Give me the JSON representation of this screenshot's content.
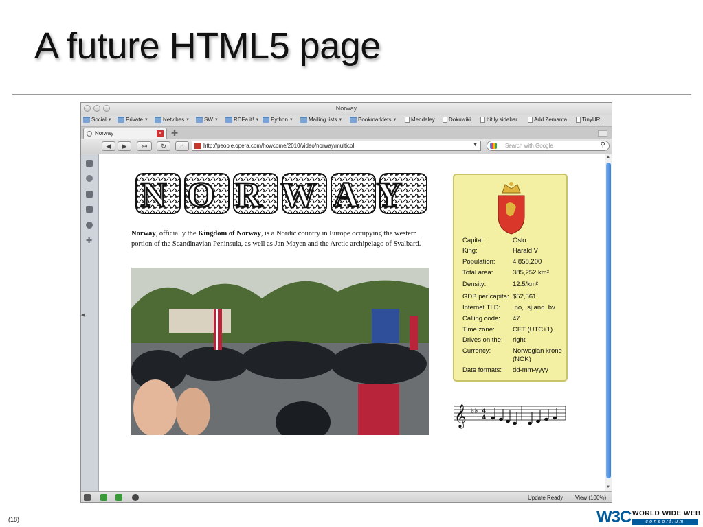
{
  "slide": {
    "title": "A future HTML5 page",
    "number": "(18)",
    "logo": {
      "mark": "W3C",
      "line1": "WORLD WIDE WEB",
      "line2": "consortium"
    }
  },
  "window": {
    "title": "Norway"
  },
  "bookmarks": [
    {
      "label": "Social",
      "kind": "folder"
    },
    {
      "label": "Private",
      "kind": "folder"
    },
    {
      "label": "Netvibes",
      "kind": "folder"
    },
    {
      "label": "SW",
      "kind": "folder"
    },
    {
      "label": "RDFa it!",
      "kind": "folder"
    },
    {
      "label": "Python",
      "kind": "folder"
    },
    {
      "label": "Mailing lists",
      "kind": "folder"
    },
    {
      "label": "Bookmarklets",
      "kind": "folder"
    },
    {
      "label": "Mendeley",
      "kind": "page"
    },
    {
      "label": "Dokuwiki",
      "kind": "page"
    },
    {
      "label": "bit.ly sidebar",
      "kind": "page"
    },
    {
      "label": "Add Zemanta",
      "kind": "page"
    },
    {
      "label": "TinyURL",
      "kind": "page"
    }
  ],
  "tab": {
    "label": "Norway"
  },
  "navbar": {
    "url": "http://people.opera.com/howcome/2010/video/norway/multicol",
    "search_placeholder": "Search with Google"
  },
  "page": {
    "heading": "NORWAY",
    "intro": {
      "b1": "Norway",
      "t1": ", officially the ",
      "b2": "Kingdom of Norway",
      "t2": ", is a Nordic country in Europe occupying the western portion of the Scandinavian Peninsula, as well as Jan Mayen and the Arctic archipelago of Svalbard."
    },
    "infobox": [
      {
        "label": "Capital:",
        "value": "Oslo"
      },
      {
        "label": "King:",
        "value": "Harald V"
      },
      {
        "label": "Population:",
        "value": "4,858,200"
      },
      {
        "label": "Total area:",
        "value": "385,252 km²"
      },
      {
        "label": "Density:",
        "value": "12.5/km²"
      },
      {
        "label": "GDB per capita:",
        "value": "$52,561"
      },
      {
        "label": "Internet TLD:",
        "value": ".no, .sj and .bv"
      },
      {
        "label": "Calling code:",
        "value": "47"
      },
      {
        "label": "Time zone:",
        "value": "CET (UTC+1)"
      },
      {
        "label": "Drives on the:",
        "value": "right"
      },
      {
        "label": "Currency:",
        "value": "Norwegian krone (NOK)"
      },
      {
        "label": "Date formats:",
        "value": "dd-mm-yyyy"
      }
    ]
  },
  "statusbar": {
    "status": "Update Ready",
    "zoom": "View (100%)"
  },
  "colors": {
    "infobox_bg": "#f3f0a3",
    "scroll_accent": "#3d7fd5",
    "w3c_blue": "#005a9c",
    "crest_red": "#d8372a",
    "crest_gold": "#e0b43c"
  },
  "icons": [
    "back-icon",
    "forward-icon",
    "key-icon",
    "reload-icon",
    "home-icon",
    "search-icon",
    "bookmark-icon",
    "close-icon",
    "new-tab-icon",
    "treble-clef-icon",
    "coat-of-arms-icon"
  ]
}
